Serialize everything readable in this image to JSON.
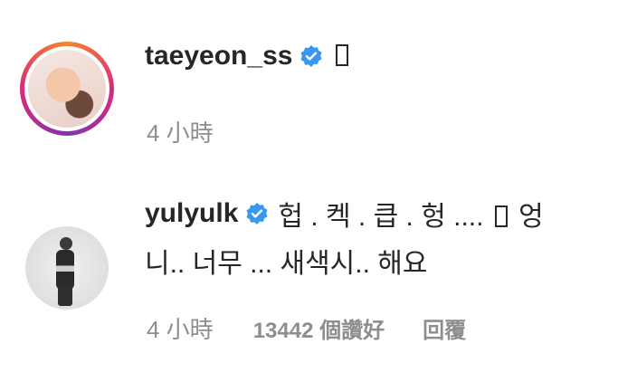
{
  "comments": [
    {
      "username": "taeyeon_ss",
      "verified": true,
      "text": "",
      "time": "4 小時"
    },
    {
      "username": "yulyulk",
      "verified": true,
      "text_line1": "헙 . 켁 . 큽 . 헝 ....",
      "text_line1_tail": "엉",
      "text_line2": "니.. 너무 ... 새색시.. 해요",
      "time": "4 小時",
      "likes": "13442 個讚好",
      "reply_label": "回覆"
    }
  ],
  "colors": {
    "text": "#262626",
    "meta": "#8e8e8e",
    "verified": "#3897f0"
  }
}
